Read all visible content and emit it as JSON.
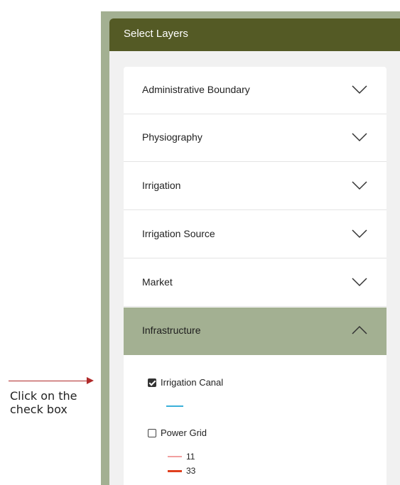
{
  "panel": {
    "title": "Select Layers"
  },
  "sections": [
    {
      "label": "Administrative Boundary",
      "expanded": false,
      "chevron": "chevron-down-icon"
    },
    {
      "label": "Physiography",
      "expanded": false,
      "chevron": "chevron-down-icon"
    },
    {
      "label": "Irrigation",
      "expanded": false,
      "chevron": "chevron-down-icon"
    },
    {
      "label": "Irrigation Source",
      "expanded": false,
      "chevron": "chevron-down-icon"
    },
    {
      "label": "Market",
      "expanded": false,
      "chevron": "chevron-down-icon"
    },
    {
      "label": "Infrastructure",
      "expanded": true,
      "chevron": "chevron-up-icon"
    }
  ],
  "infrastructure_layers": [
    {
      "label": "Irrigation Canal",
      "checked": true,
      "legend": [
        {
          "label": "",
          "color": "#3ab0d9"
        }
      ]
    },
    {
      "label": "Power Grid",
      "checked": false,
      "legend": [
        {
          "label": "11",
          "color": "#f2a0a0"
        },
        {
          "label": "33",
          "color": "#e0401e"
        }
      ]
    }
  ],
  "annotation": {
    "text": "Click on the check box",
    "arrow_color": "#b02a2a"
  },
  "colors": {
    "header": "#545a25",
    "accent": "#a3b092",
    "panel_bg": "#f1f1f1"
  }
}
